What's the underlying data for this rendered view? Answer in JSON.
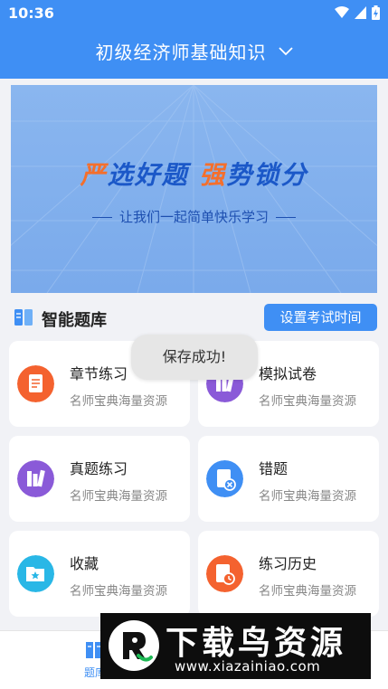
{
  "status_bar": {
    "time": "10:36"
  },
  "header": {
    "title": "初级经济师基础知识"
  },
  "banner": {
    "slogan_part1_hl": "严",
    "slogan_part2": "选好题 ",
    "slogan_part3_hl": "强",
    "slogan_part4": "势锁分",
    "subtitle": "让我们一起简单快乐学习"
  },
  "section": {
    "title": "智能题库",
    "exam_time_button": "设置考试时间"
  },
  "cards": [
    {
      "title": "章节练习",
      "subtitle": "名师宝典海量资源",
      "icon": "document-icon",
      "color": "#f4622f"
    },
    {
      "title": "模拟试卷",
      "subtitle": "名师宝典海量资源",
      "icon": "books-icon",
      "color": "#8a5ad8"
    },
    {
      "title": "真题练习",
      "subtitle": "名师宝典海量资源",
      "icon": "books-icon",
      "color": "#8a5ad8"
    },
    {
      "title": "错题",
      "subtitle": "名师宝典海量资源",
      "icon": "wrong-doc-icon",
      "color": "#3f8ff4"
    },
    {
      "title": "收藏",
      "subtitle": "名师宝典海量资源",
      "icon": "star-folder-icon",
      "color": "#29b7e6"
    },
    {
      "title": "练习历史",
      "subtitle": "名师宝典海量资源",
      "icon": "history-icon",
      "color": "#f4622f"
    }
  ],
  "toast": {
    "text": "保存成功!"
  },
  "bottom_nav": {
    "tab_label": "题库"
  },
  "watermark": {
    "name": "下载鸟资源",
    "url": "www.xiazainiao.com"
  },
  "colors": {
    "primary": "#3f8ff4",
    "accent_orange": "#f46f2c"
  }
}
